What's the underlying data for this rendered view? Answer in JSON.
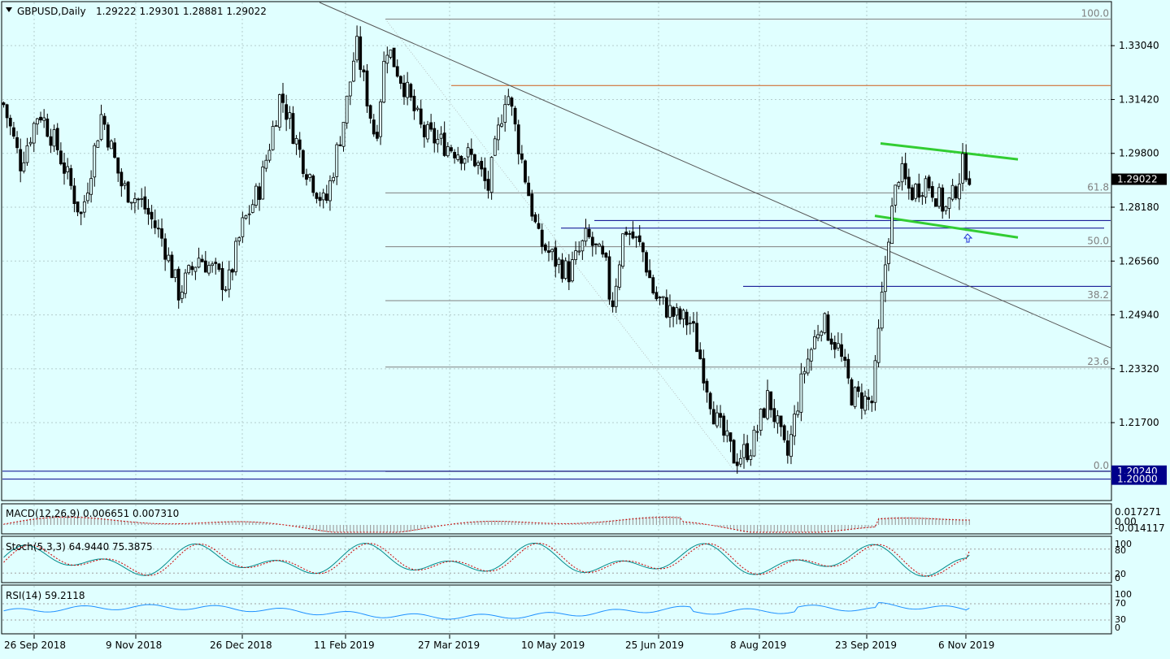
{
  "header": {
    "symbol": "GBPUSD,Daily",
    "ohlc": "1.29222 1.29301 1.28881 1.29022"
  },
  "colors": {
    "background": "#e0ffff",
    "grid": "#b4cdcd",
    "candle": "#000000",
    "fib": "#808080",
    "resistance": "#cd5c1a",
    "support_blue": "#00008b",
    "channel_green": "#32cd32",
    "macd_signal": "#cc0000",
    "stoch_main": "#008b8b",
    "stoch_signal": "#cc0000",
    "rsi": "#1e90ff",
    "price_tag": "#000000",
    "level_tag": "#00008b"
  },
  "chart_data": [
    {
      "type": "candlestick",
      "panel": "price",
      "title": "GBPUSD,Daily",
      "x_labels": [
        "26 Sep 2018",
        "9 Nov 2018",
        "26 Dec 2018",
        "11 Feb 2019",
        "27 Mar 2019",
        "10 May 2019",
        "25 Jun 2019",
        "8 Aug 2019",
        "23 Sep 2019",
        "6 Nov 2019"
      ],
      "y_ticks": [
        1.3304,
        1.3142,
        1.298,
        1.2818,
        1.2656,
        1.2494,
        1.2332,
        1.217
      ],
      "y_tick_labels": [
        "1.33040",
        "1.31420",
        "1.29800",
        "1.28180",
        "1.26560",
        "1.24940",
        "1.23320",
        "1.21700"
      ],
      "ylim": [
        1.1938,
        1.3434
      ],
      "last_price": 1.29022,
      "last_price_label": "1.29022",
      "anchor_closes": [
        {
          "x": "26 Sep 2018",
          "close": 1.315
        },
        {
          "x": "9 Nov 2018",
          "close": 1.296
        },
        {
          "x": "26 Dec 2018",
          "close": 1.271
        },
        {
          "x": "11 Feb 2019",
          "close": 1.301
        },
        {
          "x": "27 Mar 2019",
          "close": 1.312
        },
        {
          "x": "10 May 2019",
          "close": 1.286
        },
        {
          "x": "25 Jun 2019",
          "close": 1.266
        },
        {
          "x": "8 Aug 2019",
          "close": 1.209
        },
        {
          "x": "23 Sep 2019",
          "close": 1.243
        },
        {
          "x": "6 Nov 2019",
          "close": 1.29
        }
      ],
      "fibonacci": {
        "levels": [
          {
            "label": "100.0",
            "price": 1.3384
          },
          {
            "label": "61.8",
            "price": 1.2861
          },
          {
            "label": "50.0",
            "price": 1.2699
          },
          {
            "label": "38.2",
            "price": 1.2537
          },
          {
            "label": "23.6",
            "price": 1.2337
          },
          {
            "label": "0.0",
            "price": 1.2023
          }
        ]
      },
      "horizontal_levels": [
        {
          "name": "resistance",
          "price": 1.3184
        },
        {
          "name": "support-upper",
          "price": 1.2778
        },
        {
          "name": "support-lower",
          "price": 1.2755
        },
        {
          "name": "mid-level",
          "price": 1.258
        },
        {
          "name": "low-level",
          "price": 1.2024,
          "label": "1.20240"
        },
        {
          "name": "round-level",
          "price": 1.2,
          "label": "1.20000"
        }
      ]
    },
    {
      "type": "histogram",
      "panel": "macd",
      "label": "MACD(12,26,9) 0.006651 0.007310",
      "y_tick_labels": [
        "0.017271",
        "0.00",
        "-0.014117"
      ],
      "ylim": [
        -0.014117,
        0.017271
      ]
    },
    {
      "type": "line",
      "panel": "stochastic",
      "label": "Stoch(5,3,3) 64.9440 75.3875",
      "y_tick_labels": [
        "100",
        "80",
        "20",
        "0"
      ],
      "levels": [
        80,
        20
      ],
      "ylim": [
        0,
        100
      ],
      "main": 64.944,
      "signal": 75.3875
    },
    {
      "type": "line",
      "panel": "rsi",
      "label": "RSI(14) 59.2118",
      "y_tick_labels": [
        "100",
        "70",
        "30",
        "0"
      ],
      "levels": [
        70,
        30
      ],
      "ylim": [
        0,
        100
      ],
      "value": 59.2118
    }
  ]
}
